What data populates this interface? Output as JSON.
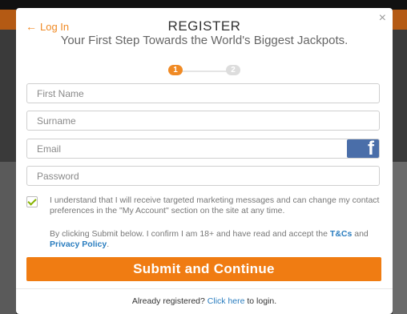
{
  "header": {
    "login_label": "Log In",
    "title": "REGISTER",
    "subtitle": "Your First Step Towards the World's Biggest Jackpots.",
    "close_glyph": "×"
  },
  "steps": {
    "current": "1",
    "next": "2"
  },
  "form": {
    "first_name_placeholder": "First Name",
    "surname_placeholder": "Surname",
    "email_placeholder": "Email",
    "password_placeholder": "Password",
    "facebook_glyph": "f"
  },
  "consent": {
    "checked": true,
    "text": "I understand that I will receive targeted marketing messages and can change my contact preferences in the \"My Account\" section on the site at any time."
  },
  "disclaimer": {
    "prefix": "By clicking Submit below. I confirm I am 18+ and have read and accept the ",
    "tcs_link": "T&Cs",
    "and": " and ",
    "privacy_link": "Privacy Policy",
    "suffix": "."
  },
  "submit_label": "Submit and Continue",
  "footer": {
    "prefix": "Already registered? ",
    "link": "Click here",
    "suffix": " to login."
  },
  "colors": {
    "accent": "#f07c12",
    "link": "#2a7dbf",
    "facebook": "#4a6ea9"
  }
}
